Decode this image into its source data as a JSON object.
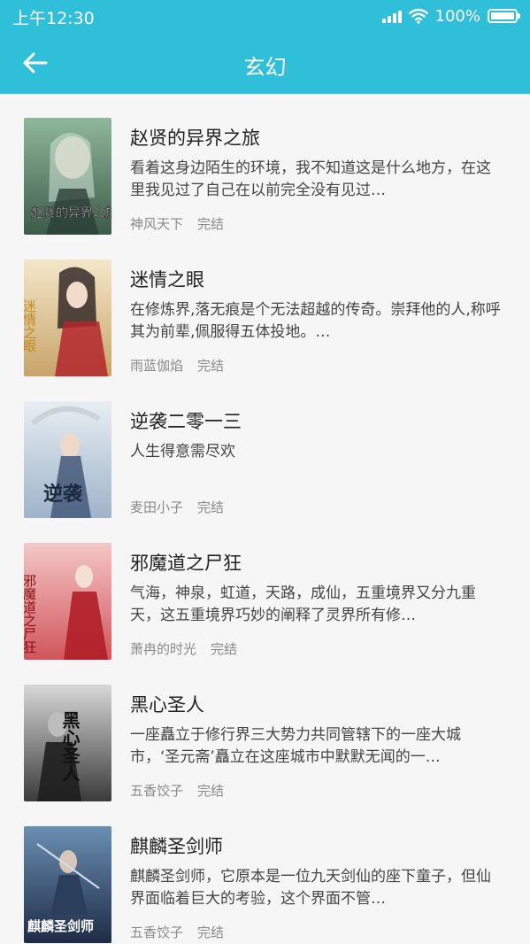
{
  "status_bar": {
    "time": "上午12:30",
    "battery": "100%"
  },
  "navbar": {
    "title": "玄幻",
    "back_icon": "arrow-left-icon"
  },
  "colors": {
    "header": "#2fbfd8",
    "background": "#f6f6f6"
  },
  "books": [
    {
      "title": "赵贤的异界之旅",
      "desc": "看着这身边陌生的环境，我不知道这是什么地方，在这里我见过了自己在以前完全没有见过…",
      "author": "神风天下",
      "status": "完结",
      "cover_text": "赵贤的异界之旅",
      "cover_colors": [
        "#8fb89a",
        "#3d5a4a"
      ]
    },
    {
      "title": "迷情之眼",
      "desc": "在修炼界,落无痕是个无法超越的传奇。崇拜他的人,称呼其为前辈,佩服得五体投地。…",
      "author": "雨蓝伽焰",
      "status": "完结",
      "cover_text": "迷情之眼",
      "cover_colors": [
        "#f3e7c9",
        "#c8a46a"
      ]
    },
    {
      "title": "逆袭二零一三",
      "desc": "人生得意需尽欢",
      "author": "麦田小子",
      "status": "完结",
      "cover_text": "逆袭",
      "cover_colors": [
        "#e8eef3",
        "#9fb3c8"
      ]
    },
    {
      "title": "邪魔道之尸狂",
      "desc": "气海，神泉，虹道，天路，成仙，五重境界又分九重天，这五重境界巧妙的阐释了灵界所有修…",
      "author": "萧冉的时光",
      "status": "完结",
      "cover_text": "邪魔道之尸狂",
      "cover_colors": [
        "#f4c7c7",
        "#d0555a"
      ]
    },
    {
      "title": "黑心圣人",
      "desc": "一座矗立于修行界三大势力共同管辖下的一座大城市，‘圣元斋’矗立在这座城市中默默无闻的一…",
      "author": "五香饺子",
      "status": "完结",
      "cover_text": "黑心圣人",
      "cover_colors": [
        "#d8d8d8",
        "#3a3a3a"
      ]
    },
    {
      "title": "麒麟圣剑师",
      "desc": "麒麟圣剑师，它原本是一位九天剑仙的座下童子，但仙界面临着巨大的考验，这个界面不管…",
      "author": "五香饺子",
      "status": "完结",
      "cover_text": "麒麟圣剑师",
      "cover_colors": [
        "#6b8fb3",
        "#1d2c45"
      ]
    }
  ]
}
